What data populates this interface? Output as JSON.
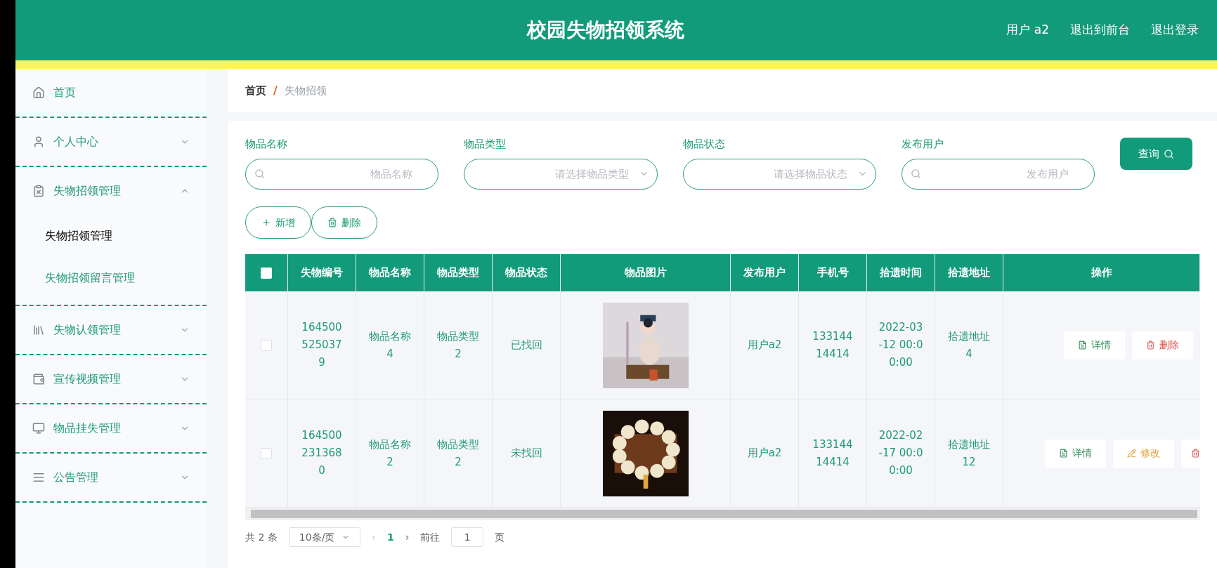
{
  "header": {
    "title": "校园失物招领系统",
    "links": [
      "用户 a2",
      "退出到前台",
      "退出登录"
    ]
  },
  "sidebar": {
    "items": [
      {
        "label": "首页"
      },
      {
        "label": "个人中心",
        "expanded": false
      },
      {
        "label": "失物招领管理",
        "expanded": true,
        "children": [
          {
            "label": "失物招领管理",
            "selected": true
          },
          {
            "label": "失物招领留言管理",
            "selected": false
          }
        ]
      },
      {
        "label": "失物认领管理",
        "expanded": false
      },
      {
        "label": "宣传视频管理",
        "expanded": false
      },
      {
        "label": "物品挂失管理",
        "expanded": false
      },
      {
        "label": "公告管理",
        "expanded": false
      }
    ]
  },
  "breadcrumb": [
    "首页",
    "失物招领"
  ],
  "breadcrumb_separator": "/",
  "filters": [
    {
      "label": "物品名称",
      "kind": "search",
      "placeholder": "物品名称"
    },
    {
      "label": "物品类型",
      "kind": "select",
      "placeholder": "请选择物品类型"
    },
    {
      "label": "物品状态",
      "kind": "select",
      "placeholder": "请选择物品状态"
    },
    {
      "label": "发布用户",
      "kind": "search",
      "placeholder": "发布用户"
    }
  ],
  "query_button": "查询",
  "actions": [
    {
      "kind": "add",
      "label": "新增"
    },
    {
      "kind": "delete",
      "label": "删除"
    }
  ],
  "table": {
    "all_checked": false,
    "columns": [
      "失物编号",
      "物品名称",
      "物品类型",
      "物品状态",
      "物品图片",
      "发布用户",
      "手机号",
      "拾遗时间",
      "拾遗地址",
      "操作"
    ],
    "rows": [
      {
        "checked": false,
        "cells": [
          "1645005250379",
          "物品名称4",
          "物品类型2",
          "已找回",
          {
            "kind": "picture"
          },
          "用户a2",
          "13314414414",
          "2022-03-12 00:00:00",
          "拾遗地址4"
        ],
        "ops": [
          {
            "kind": "detail",
            "label": "详情"
          },
          {
            "kind": "delete",
            "label": "删除"
          }
        ]
      },
      {
        "checked": false,
        "cells": [
          "1645002313680",
          "物品名称2",
          "物品类型2",
          "未找回",
          {
            "kind": "picture"
          },
          "用户a2",
          "13314414414",
          "2022-02-17 00:00:00",
          "拾遗地址12"
        ],
        "ops": [
          {
            "kind": "detail",
            "label": "详情"
          },
          {
            "kind": "edit",
            "label": "修改"
          },
          {
            "kind": "delete"
          }
        ]
      }
    ]
  },
  "pagination": {
    "total": "共 2 条",
    "page_size": "10条/页",
    "prev": "‹",
    "current": "1",
    "next": "›",
    "goto": "前往",
    "goto_value": "1",
    "page_unit": "页"
  }
}
